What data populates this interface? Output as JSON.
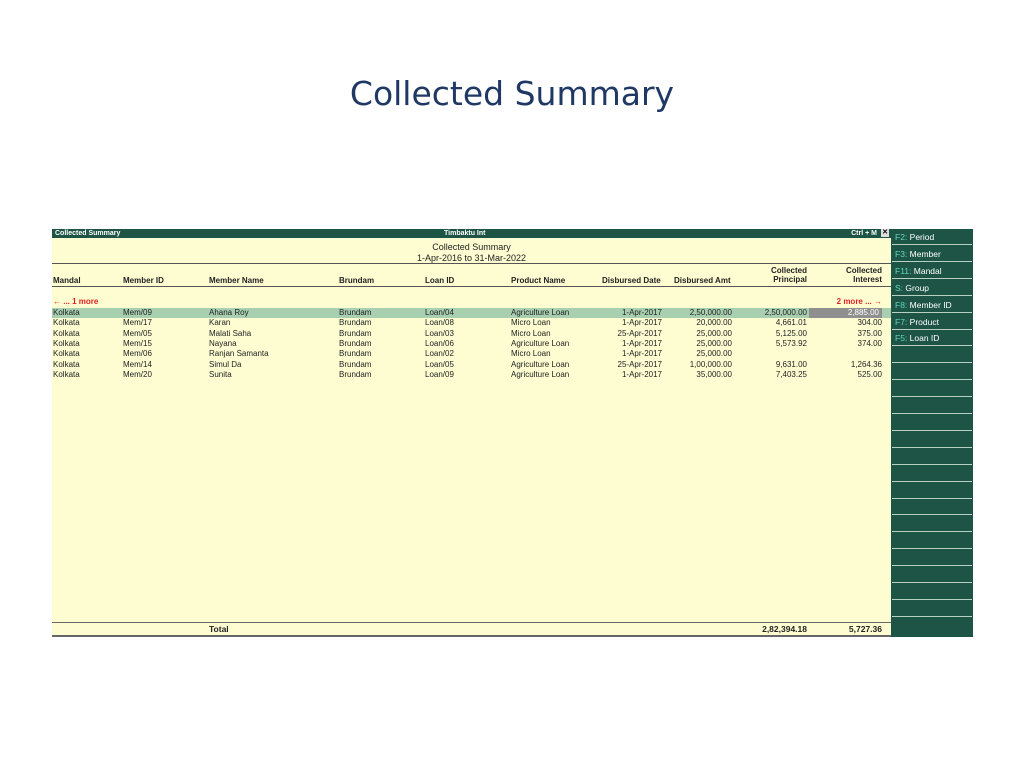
{
  "slide_title": "Collected Summary",
  "window": {
    "title_left": "Collected Summary",
    "title_center": "Timbaktu Int",
    "title_right": "Ctrl + M",
    "close_glyph": "✕"
  },
  "report": {
    "title": "Collected Summary",
    "period": "1-Apr-2016 to 31-Mar-2022"
  },
  "columns": {
    "mandal": "Mandal",
    "member_id": "Member ID",
    "member_name": "Member Name",
    "brundam": "Brundam",
    "loan_id": "Loan ID",
    "product_name": "Product Name",
    "disbursed_date": "Disbursed Date",
    "disbursed_amt": "Disbursed Amt",
    "collected_principal_1": "Collected",
    "collected_principal_2": "Principal",
    "collected_interest_1": "Collected",
    "collected_interest_2": "Interest"
  },
  "more_left": "← ... 1 more",
  "more_right": "2 more ... →",
  "rows": [
    {
      "mandal": "Kolkata",
      "member_id": "Mem/09",
      "member_name": "Ahana Roy",
      "brundam": "Brundam",
      "loan_id": "Loan/04",
      "product": "Agriculture Loan",
      "date": "1-Apr-2017",
      "amt": "2,50,000.00",
      "principal": "2,50,000.00",
      "interest": "2,885.00"
    },
    {
      "mandal": "Kolkata",
      "member_id": "Mem/17",
      "member_name": "Karan",
      "brundam": "Brundam",
      "loan_id": "Loan/08",
      "product": "Micro Loan",
      "date": "1-Apr-2017",
      "amt": "20,000.00",
      "principal": "4,661.01",
      "interest": "304.00"
    },
    {
      "mandal": "Kolkata",
      "member_id": "Mem/05",
      "member_name": "Malati Saha",
      "brundam": "Brundam",
      "loan_id": "Loan/03",
      "product": "Micro Loan",
      "date": "25-Apr-2017",
      "amt": "25,000.00",
      "principal": "5,125.00",
      "interest": "375.00"
    },
    {
      "mandal": "Kolkata",
      "member_id": "Mem/15",
      "member_name": "Nayana",
      "brundam": "Brundam",
      "loan_id": "Loan/06",
      "product": "Agriculture Loan",
      "date": "1-Apr-2017",
      "amt": "25,000.00",
      "principal": "5,573.92",
      "interest": "374.00"
    },
    {
      "mandal": "Kolkata",
      "member_id": "Mem/06",
      "member_name": "Ranjan Samanta",
      "brundam": "Brundam",
      "loan_id": "Loan/02",
      "product": "Micro Loan",
      "date": "1-Apr-2017",
      "amt": "25,000.00",
      "principal": "",
      "interest": ""
    },
    {
      "mandal": "Kolkata",
      "member_id": "Mem/14",
      "member_name": "Simul Da",
      "brundam": "Brundam",
      "loan_id": "Loan/05",
      "product": "Agriculture Loan",
      "date": "25-Apr-2017",
      "amt": "1,00,000.00",
      "principal": "9,631.00",
      "interest": "1,264.36"
    },
    {
      "mandal": "Kolkata",
      "member_id": "Mem/20",
      "member_name": "Sunita",
      "brundam": "Brundam",
      "loan_id": "Loan/09",
      "product": "Agriculture Loan",
      "date": "1-Apr-2017",
      "amt": "35,000.00",
      "principal": "7,403.25",
      "interest": "525.00"
    }
  ],
  "total": {
    "label": "Total",
    "principal": "2,82,394.18",
    "interest": "5,727.36"
  },
  "sidebar": [
    {
      "key": "F2",
      "label": "Period"
    },
    {
      "key": "F3",
      "label": "Member"
    },
    {
      "key": "F11",
      "label": "Mandal"
    },
    {
      "key": "S",
      "label": "Group"
    },
    {
      "key": "F8",
      "label": "Member ID"
    },
    {
      "key": "F7",
      "label": "Product"
    },
    {
      "key": "F5",
      "label": "Loan ID"
    }
  ],
  "colors": {
    "titlebar_bg": "#1d5445",
    "report_bg": "#fefdd2",
    "selected_row": "#a7cfb0",
    "more_text": "#e02020",
    "sidebar_key": "#62d6c0"
  }
}
